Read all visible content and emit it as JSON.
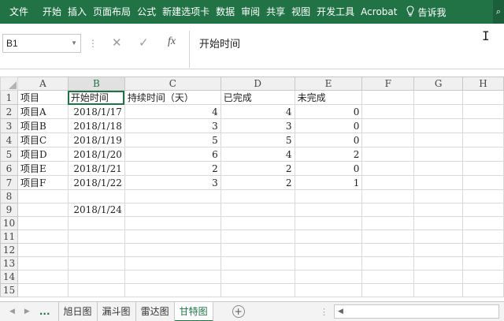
{
  "ribbon": {
    "tabs": [
      "文件",
      "开始",
      "插入",
      "页面布局",
      "公式",
      "新建选项卡",
      "数据",
      "审阅",
      "共享",
      "视图",
      "开发工具",
      "Acrobat"
    ],
    "tell_me": "告诉我"
  },
  "formula_bar": {
    "name_box": "B1",
    "fx_label": "fx",
    "content": "开始时间"
  },
  "grid": {
    "columns": [
      "A",
      "B",
      "C",
      "D",
      "E",
      "F",
      "G",
      "H"
    ],
    "rows": [
      {
        "n": "1",
        "cells": [
          "项目",
          "开始时间",
          "持续时间（天）",
          "已完成",
          "未完成",
          "",
          "",
          ""
        ]
      },
      {
        "n": "2",
        "cells": [
          "项目A",
          "2018/1/17",
          "4",
          "4",
          "0",
          "",
          "",
          ""
        ]
      },
      {
        "n": "3",
        "cells": [
          "项目B",
          "2018/1/18",
          "3",
          "3",
          "0",
          "",
          "",
          ""
        ]
      },
      {
        "n": "4",
        "cells": [
          "项目C",
          "2018/1/19",
          "5",
          "5",
          "0",
          "",
          "",
          ""
        ]
      },
      {
        "n": "5",
        "cells": [
          "项目D",
          "2018/1/20",
          "6",
          "4",
          "2",
          "",
          "",
          ""
        ]
      },
      {
        "n": "6",
        "cells": [
          "项目E",
          "2018/1/21",
          "2",
          "2",
          "0",
          "",
          "",
          ""
        ]
      },
      {
        "n": "7",
        "cells": [
          "项目F",
          "2018/1/22",
          "3",
          "2",
          "1",
          "",
          "",
          ""
        ]
      },
      {
        "n": "8",
        "cells": [
          "",
          "",
          "",
          "",
          "",
          "",
          "",
          ""
        ]
      },
      {
        "n": "9",
        "cells": [
          "",
          "2018/1/24",
          "",
          "",
          "",
          "",
          "",
          ""
        ]
      },
      {
        "n": "10",
        "cells": [
          "",
          "",
          "",
          "",
          "",
          "",
          "",
          ""
        ]
      },
      {
        "n": "11",
        "cells": [
          "",
          "",
          "",
          "",
          "",
          "",
          "",
          ""
        ]
      },
      {
        "n": "12",
        "cells": [
          "",
          "",
          "",
          "",
          "",
          "",
          "",
          ""
        ]
      },
      {
        "n": "13",
        "cells": [
          "",
          "",
          "",
          "",
          "",
          "",
          "",
          ""
        ]
      },
      {
        "n": "14",
        "cells": [
          "",
          "",
          "",
          "",
          "",
          "",
          "",
          ""
        ]
      },
      {
        "n": "15",
        "cells": [
          "",
          "",
          "",
          "",
          "",
          "",
          "",
          ""
        ]
      }
    ]
  },
  "sheet_tabs": {
    "dots": "...",
    "tabs": [
      "旭日图",
      "漏斗图",
      "雷达图",
      "甘特图"
    ],
    "active": "甘特图",
    "add": "+"
  },
  "colors": {
    "ribbon": "#217346",
    "active_tab": "#217346"
  }
}
